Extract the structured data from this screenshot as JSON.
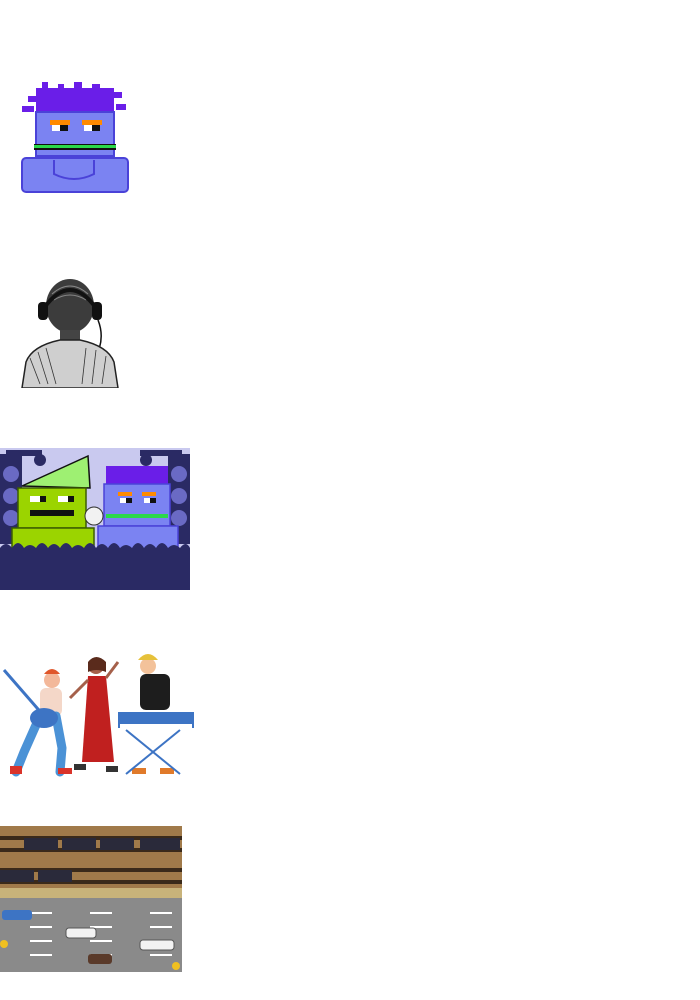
{
  "images": [
    {
      "name": "blue-monster-avatar",
      "kind": "pixel-art",
      "colors": {
        "body": "#7b83f2",
        "hair": "#6a1ee8",
        "mouth": "#2bd94a",
        "brow": "#ff8a00"
      }
    },
    {
      "name": "headphones-listener",
      "kind": "sketch",
      "colors": {
        "ink": "#222222"
      }
    },
    {
      "name": "monster-concert-scene",
      "kind": "pixel-art",
      "colors": {
        "stage": "#2a2a64",
        "green-monster": "#9bd400",
        "blue-monster": "#7b83f2"
      }
    },
    {
      "name": "band-illustration",
      "kind": "illustration",
      "colors": {
        "dress": "#c0201f",
        "keyboard": "#3d74c4",
        "guitar": "#3d74c4"
      }
    },
    {
      "name": "frogger-road-map",
      "kind": "pixel-art",
      "colors": {
        "rail-bed": "#a07a4a",
        "road": "#8a8a8a",
        "lane-mark": "#ffffff"
      }
    }
  ]
}
